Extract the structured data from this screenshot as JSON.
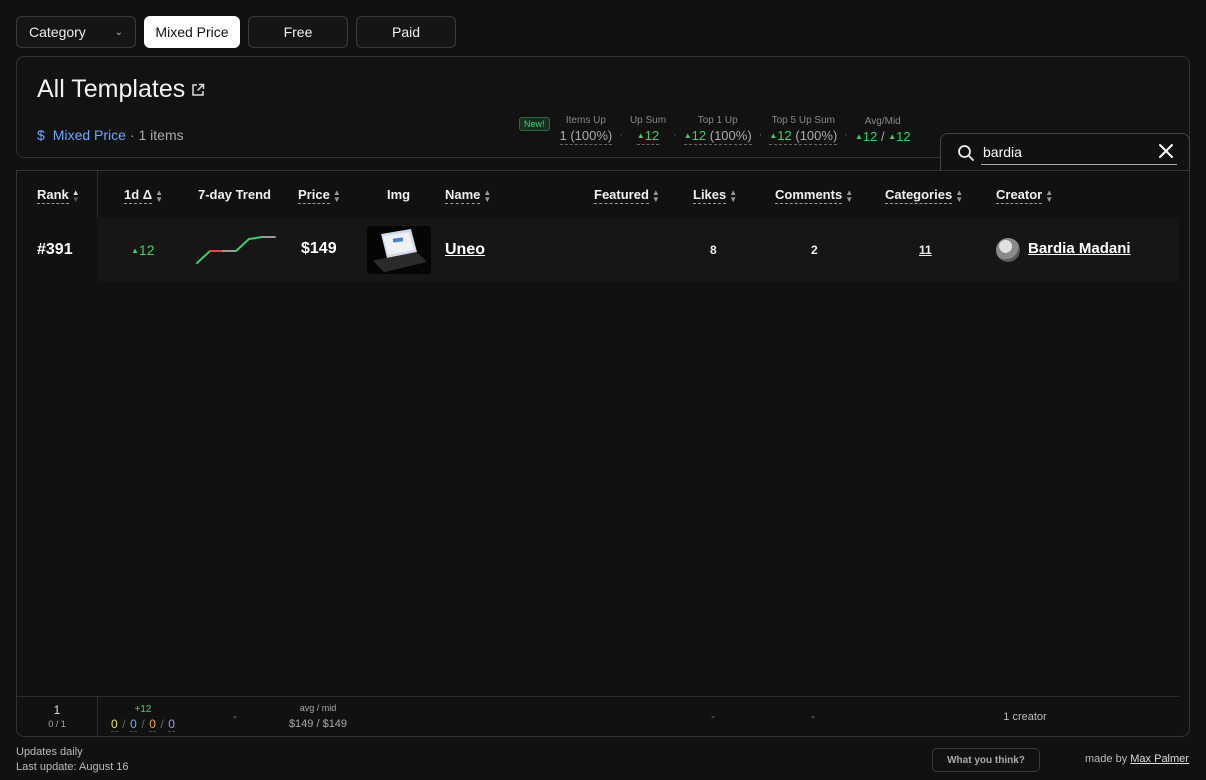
{
  "filters": {
    "category_label": "Category",
    "price_tabs": [
      {
        "label": "Mixed Price",
        "active": true
      },
      {
        "label": "Free",
        "active": false
      },
      {
        "label": "Paid",
        "active": false
      }
    ]
  },
  "header": {
    "title": "All Templates",
    "price_type": "Mixed Price",
    "dollar": "$",
    "item_count": "· 1 items"
  },
  "stats": {
    "new_badge": "New!",
    "items_up": {
      "label": "Items Up",
      "value": "1 (100%)"
    },
    "up_sum": {
      "label": "Up Sum",
      "value": "12"
    },
    "top1_up": {
      "label": "Top 1 Up",
      "value": "12",
      "pct": "(100%)"
    },
    "top5_up": {
      "label": "Top 5 Up Sum",
      "value": "12",
      "pct": "(100%)"
    },
    "avg_mid": {
      "label": "Avg/Mid",
      "avg": "12",
      "sep": "/",
      "mid": "12"
    }
  },
  "search": {
    "value": "bardia"
  },
  "table": {
    "headers": {
      "rank": "Rank",
      "delta": "1d Δ",
      "trend": "7-day Trend",
      "price": "Price",
      "img": "Img",
      "name": "Name",
      "featured": "Featured",
      "likes": "Likes",
      "comments": "Comments",
      "categories": "Categories",
      "creator": "Creator"
    },
    "rows": [
      {
        "rank": "#391",
        "delta": "12",
        "trend": [
          0,
          6,
          6,
          6,
          12,
          13,
          13
        ],
        "price": "$149",
        "name": "Uneo",
        "featured": "",
        "likes": "8",
        "comments": "2",
        "categories": "11",
        "creator": "Bardia Madani"
      }
    ],
    "footer": {
      "count": "1",
      "ratio": "0 / 1",
      "delta": "+12",
      "mini": [
        "0",
        "0",
        "0",
        "0"
      ],
      "mini_colors": [
        "#e3e04a",
        "#5fb3ff",
        "#f0a83a",
        "#a98bff"
      ],
      "mini_sep": "/",
      "trend_dash": "-",
      "avg_label": "avg / mid",
      "avg_value": "$149 / $149",
      "likes_dash": "-",
      "comments_dash": "-",
      "creators": "1 creator"
    }
  },
  "footer": {
    "updates": "Updates daily",
    "last_update": "Last update: August 16",
    "feedback": "What you think?",
    "made_by_prefix": "made by",
    "author": "Max Palmer"
  },
  "colors": {
    "accent_blue": "#6aa7ff",
    "up_green": "#3fcf6a",
    "trend_red": "#e04848"
  }
}
